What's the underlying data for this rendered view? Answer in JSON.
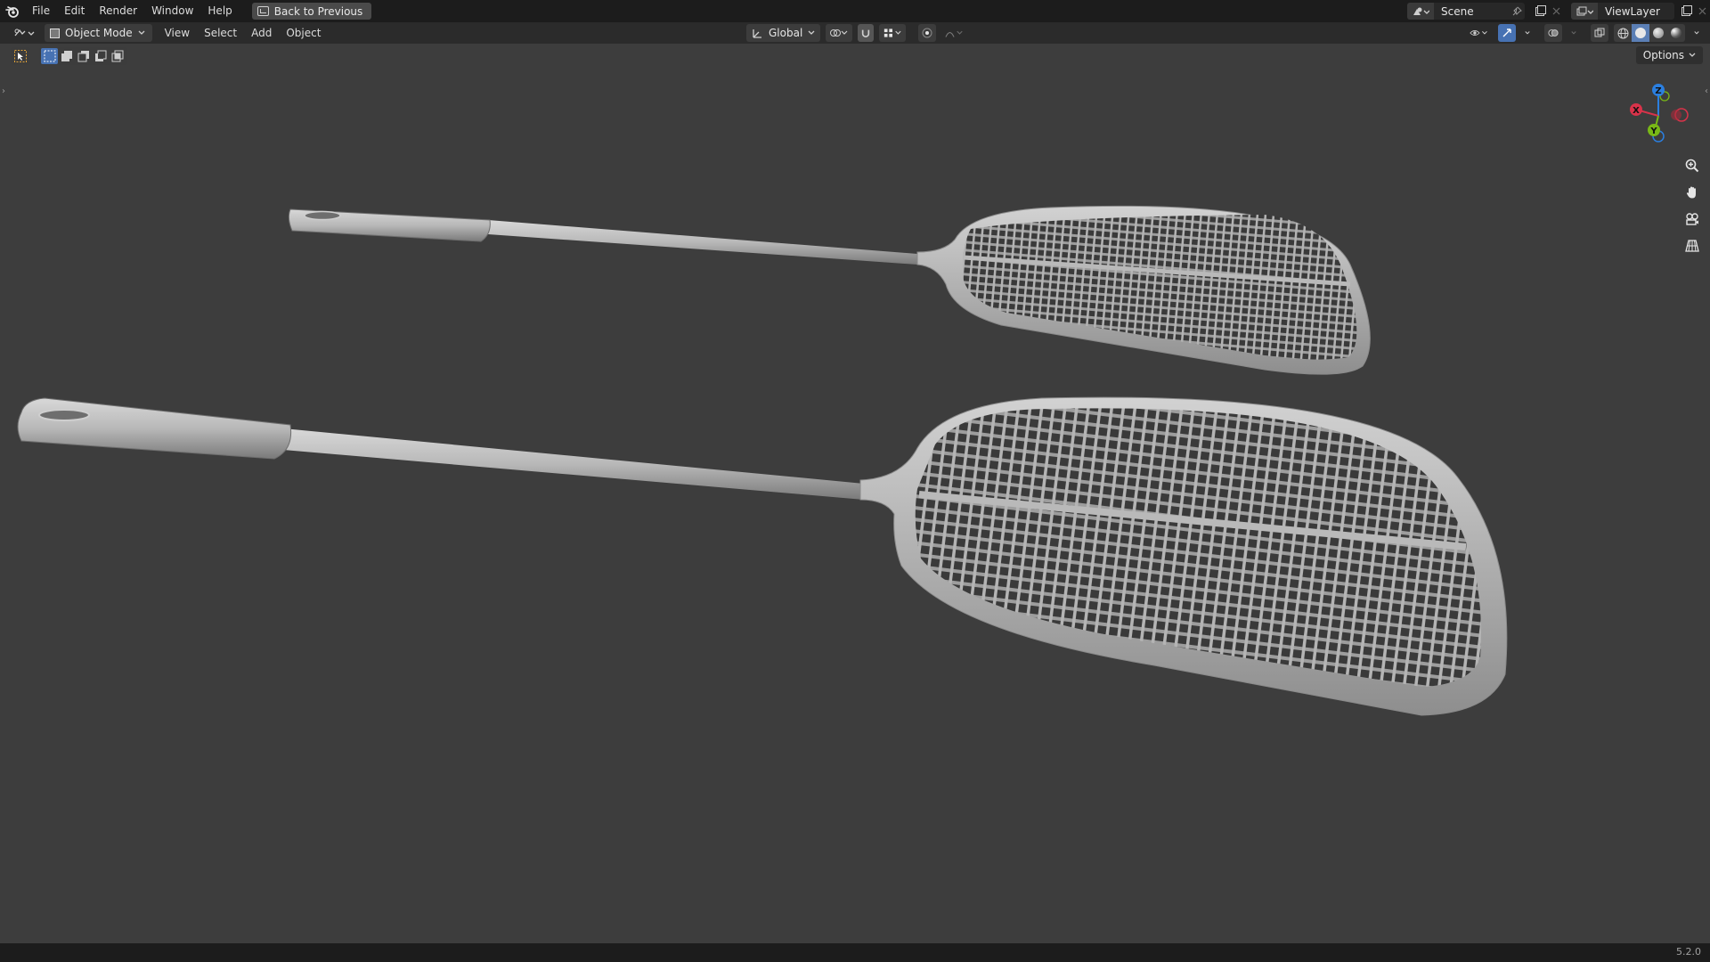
{
  "topbar": {
    "menus": [
      "File",
      "Edit",
      "Render",
      "Window",
      "Help"
    ],
    "back_label": "Back to Previous",
    "scene_name": "Scene",
    "viewlayer_name": "ViewLayer"
  },
  "header": {
    "mode_label": "Object Mode",
    "menus": [
      "View",
      "Select",
      "Add",
      "Object"
    ],
    "pivot_label": "Global",
    "options_label": "Options"
  },
  "gizmo": {
    "axes": [
      {
        "label": "Z",
        "color": "#2b7fe0"
      },
      {
        "label": "X",
        "color": "#d9334a"
      },
      {
        "label": "Y",
        "color": "#79b817"
      }
    ]
  },
  "nav_tools": [
    "zoom-icon",
    "pan-hand-icon",
    "camera-icon",
    "grid-perspective-icon"
  ],
  "status": {
    "version": "5.2.0"
  },
  "colors": {
    "background": "#3d3d3d",
    "topbar": "#1c1c1c",
    "header": "#2b2b2b",
    "accent": "#4772b3"
  }
}
